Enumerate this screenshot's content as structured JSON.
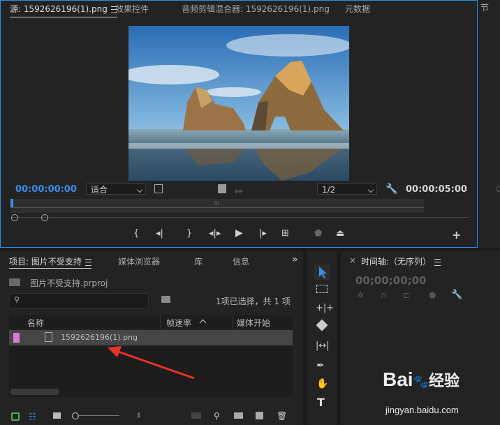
{
  "source_monitor": {
    "tabs": [
      "源: 1592626196(1).png",
      "效果控件",
      "音频剪辑混合器: 1592626196(1).png",
      "元数据"
    ],
    "right_tab": "节",
    "current_timecode": "00:00:00:00",
    "fit_option": "适合",
    "resolution": "1/2",
    "duration_timecode": "00:00:05:00",
    "right_edge_digit": "0",
    "ruler_mid_mark": "lll",
    "controls": {
      "mark_in": "{",
      "mark_out": "}",
      "add": "+"
    }
  },
  "project_panel": {
    "tabs": [
      "项目: 图片不受支持",
      "媒体浏览器",
      "库",
      "信息"
    ],
    "overflow": "»",
    "project_file": "图片不受支持.prproj",
    "selection_info": "1项已选择，共 1 项",
    "columns": [
      "名称",
      "帧速率",
      "媒体开始"
    ],
    "files": [
      {
        "name": "1592626196(1).png",
        "label_color": "#d57bd6"
      }
    ]
  },
  "timeline_panel": {
    "title": "时间轴:（无序列）",
    "timecode": "00;00;00;00"
  },
  "tools": [
    "select-tool",
    "track-select-tool",
    "ripple-edit-tool",
    "razor-tool",
    "slip-tool",
    "pen-tool",
    "hand-tool",
    "type-tool"
  ],
  "tool_labels": {
    "type": "T"
  },
  "watermark": {
    "brand": "Bai",
    "brand2": "经验",
    "url": "jingyan.baidu.com"
  },
  "colors": {
    "accent": "#2d8ceb",
    "annotation_arrow": "#e8322b"
  }
}
